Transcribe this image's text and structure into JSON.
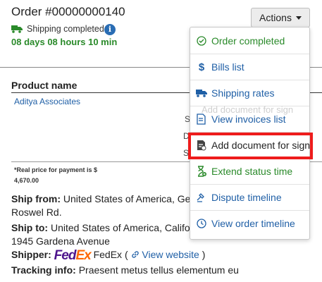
{
  "order": {
    "title": "Order #00000000140",
    "status": "Shipping completed",
    "countdown": "08 days 08 hours 10 min",
    "info_glyph": "i"
  },
  "actions_button": {
    "label": "Actions"
  },
  "table": {
    "column_header": "Product name",
    "vendor": "Aditya Associates",
    "partial_labels": [
      "S",
      "D",
      "S"
    ],
    "price_note": "*Real price for payment is $",
    "price_value": "4,670.00"
  },
  "details": {
    "ship_from_label": "Ship from:",
    "ship_from_value": "United States of America, Ge",
    "ship_from_line2": "Roswel Rd.",
    "ship_to_label": "Ship to:",
    "ship_to_value": "United States of America, Califor",
    "ship_to_line2": "1945 Gardena Avenue",
    "shipper_label": "Shipper:",
    "shipper_logo_fe": "Fed",
    "shipper_logo_ex": "Ex",
    "shipper_name": "FedEx (",
    "shipper_link": "View website",
    "shipper_close": ")",
    "tracking_label": "Tracking info:",
    "tracking_value": "Praesent metus tellus elementum eu"
  },
  "menu": {
    "items": [
      {
        "label": "Order completed",
        "icon": "check-circle-icon"
      },
      {
        "label": "Bills list",
        "icon": "dollar-icon"
      },
      {
        "label": "Shipping rates",
        "icon": "truck-icon"
      },
      {
        "label": "View invoices list",
        "icon": "invoice-icon"
      },
      {
        "label": "Add document for sign",
        "icon": "document-sign-icon"
      },
      {
        "label": "Extend status time",
        "icon": "hourglass-plus-icon"
      },
      {
        "label": "Dispute timeline",
        "icon": "gavel-icon"
      },
      {
        "label": "View order timeline",
        "icon": "clock-icon"
      }
    ],
    "ghost_text": "Add document for sign"
  },
  "colors": {
    "link": "#1f5fa6",
    "success": "#2a8a2a",
    "highlight": "#ee1c1c",
    "fedex_purple": "#4d148c",
    "fedex_orange": "#ff6600"
  }
}
